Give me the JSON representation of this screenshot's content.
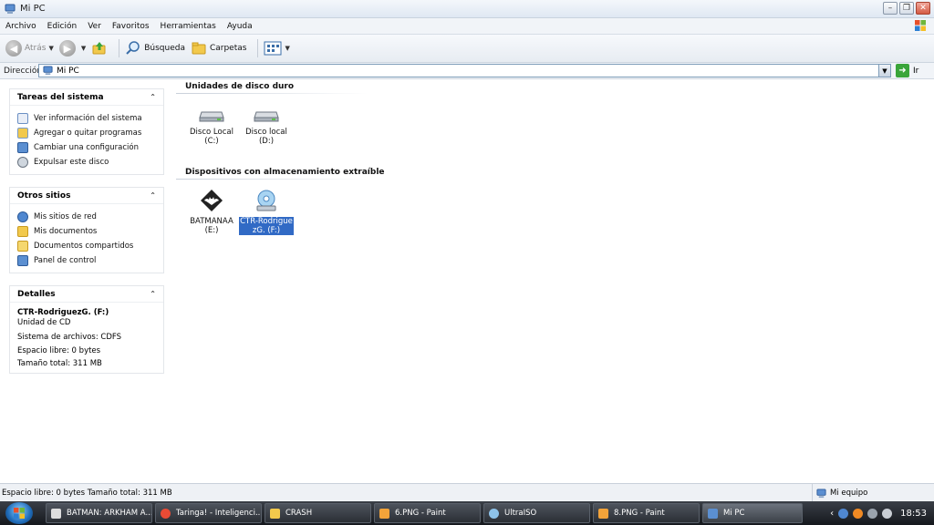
{
  "window": {
    "title": "Mi PC"
  },
  "menu": [
    "Archivo",
    "Edición",
    "Ver",
    "Favoritos",
    "Herramientas",
    "Ayuda"
  ],
  "toolbar": {
    "back_label": "Atrás",
    "search_label": "Búsqueda",
    "folders_label": "Carpetas"
  },
  "address": {
    "label": "Dirección",
    "value": "Mi PC",
    "go_label": "Ir"
  },
  "panels": {
    "system_tasks": {
      "title": "Tareas del sistema",
      "items": [
        "Ver información del sistema",
        "Agregar o quitar programas",
        "Cambiar una configuración",
        "Expulsar este disco"
      ]
    },
    "other_places": {
      "title": "Otros sitios",
      "items": [
        "Mis sitios de red",
        "Mis documentos",
        "Documentos compartidos",
        "Panel de control"
      ]
    },
    "details": {
      "title": "Detalles",
      "name": "CTR-RodriguezG. (F:)",
      "type": "Unidad de CD",
      "filesystem": "Sistema de archivos: CDFS",
      "free": "Espacio libre: 0 bytes",
      "total": "Tamaño total: 311 MB"
    }
  },
  "sections": {
    "hard_drives": {
      "title": "Unidades de disco duro",
      "drives": [
        {
          "line1": "Disco Local",
          "line2": "(C:)"
        },
        {
          "line1": "Disco local (D:)",
          "line2": ""
        }
      ]
    },
    "removable": {
      "title": "Dispositivos con almacenamiento extraíble",
      "drives": [
        {
          "line1": "BATMANAA",
          "line2": "(E:)"
        },
        {
          "line1": "CTR-Rodrigue",
          "line2": "zG. (F:)"
        }
      ]
    }
  },
  "status": {
    "left": "Espacio libre: 0 bytes Tamaño total: 311 MB",
    "right": "Mi equipo"
  },
  "taskbar": {
    "items": [
      "BATMAN: ARKHAM A...",
      "Taringa! - Inteligenci...",
      "CRASH",
      "6.PNG - Paint",
      "UltraISO",
      "8.PNG - Paint",
      "Mi PC"
    ],
    "clock": "18:53"
  },
  "colors": {
    "selection": "#316ac5",
    "taskbar": "#1e2227"
  },
  "icons": {
    "title": "my-computer-icon",
    "back": "back-arrow-icon",
    "forward": "forward-arrow-icon",
    "up": "folder-up-icon",
    "search": "search-icon",
    "folders": "folders-icon",
    "views": "views-icon"
  }
}
